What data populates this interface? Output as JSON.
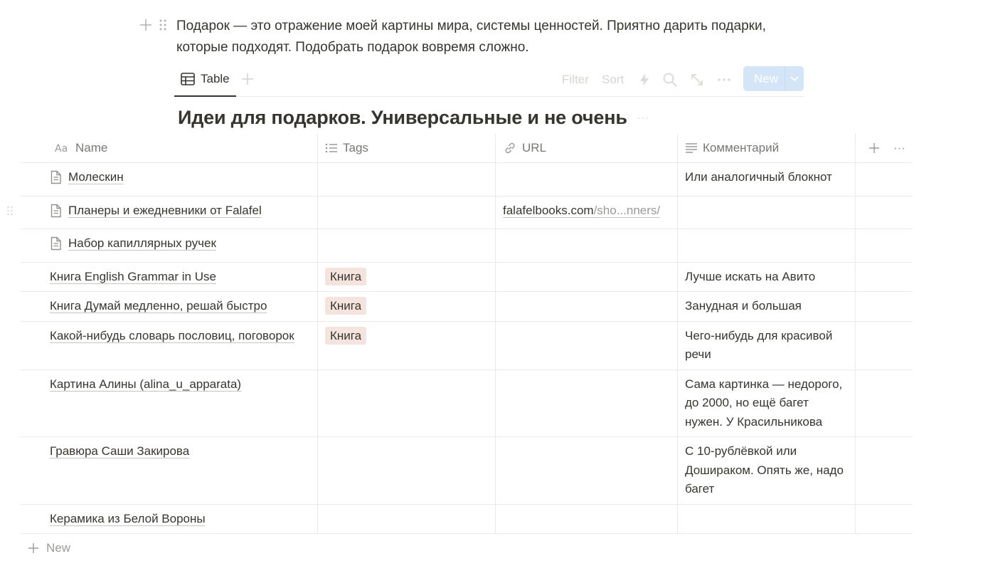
{
  "paragraph": {
    "text": "Подарок — это отражение моей картины мира, системы ценностей. Приятно дарить подарки, которые подходят. Подобрать подарок вовремя сложно."
  },
  "view": {
    "tab_label": "Table",
    "toolbar": {
      "filter_label": "Filter",
      "sort_label": "Sort",
      "new_label": "New"
    }
  },
  "database": {
    "title": "Идеи для подарков. Универсальные и не очень",
    "more_label": "···"
  },
  "table": {
    "columns": {
      "name": "Name",
      "tags": "Tags",
      "url": "URL",
      "comment": "Комментарий"
    },
    "more_label": "···",
    "rows": [
      {
        "name": "Молескин",
        "has_page_icon": true,
        "tag": "",
        "url_main": "",
        "url_rest": "",
        "comment": "Или аналогичный блокнот"
      },
      {
        "name": "Планеры и ежедневники от Falafel",
        "has_page_icon": true,
        "tag": "",
        "url_main": "falafelbooks.com",
        "url_rest": "/sho...nners/",
        "comment": ""
      },
      {
        "name": "Набор капиллярных ручек",
        "has_page_icon": true,
        "tag": "",
        "url_main": "",
        "url_rest": "",
        "comment": ""
      },
      {
        "name": "Книга English Grammar in Use",
        "has_page_icon": false,
        "tag": "Книга",
        "url_main": "",
        "url_rest": "",
        "comment": "Лучше искать на Авито"
      },
      {
        "name": "Книга Думай медленно, решай быстро",
        "has_page_icon": false,
        "tag": "Книга",
        "url_main": "",
        "url_rest": "",
        "comment": "Занудная и большая"
      },
      {
        "name": "Какой-нибудь словарь пословиц, поговорок",
        "has_page_icon": false,
        "tag": "Книга",
        "url_main": "",
        "url_rest": "",
        "comment": "Чего-нибудь для красивой речи"
      },
      {
        "name": "Картина Алины (alina_u_apparata)",
        "has_page_icon": false,
        "tag": "",
        "url_main": "",
        "url_rest": "",
        "comment": "Сама картинка — недорого, до 2000, но ещё багет нужен. У Красильникова"
      },
      {
        "name": "Гравюра Саши Закирова",
        "has_page_icon": false,
        "tag": "",
        "url_main": "",
        "url_rest": "",
        "comment": "С 10-рублёвкой или Дошираком. Опять же, надо багет"
      },
      {
        "name": "Керамика из Белой Вороны",
        "has_page_icon": false,
        "tag": "",
        "url_main": "",
        "url_rest": "",
        "comment": ""
      }
    ],
    "new_row_label": "New"
  },
  "colors": {
    "text": "#37352f",
    "muted": "#787774",
    "border": "#e9e9e7",
    "tag_bg": "#f4e4dd",
    "new_button_bg": "#d3e5f7"
  }
}
